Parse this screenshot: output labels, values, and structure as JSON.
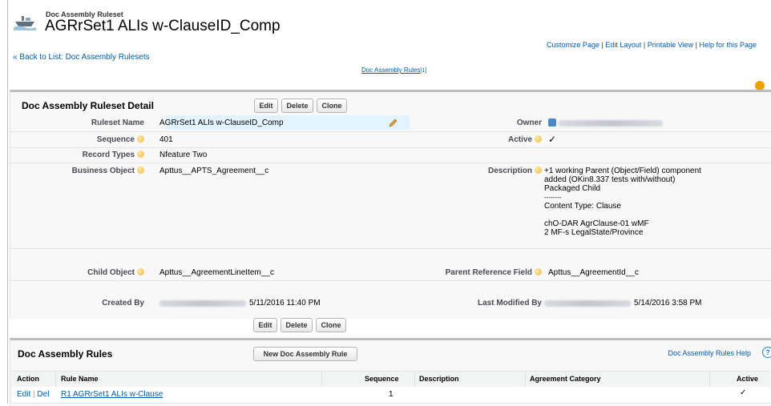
{
  "header": {
    "object_type": "Doc Assembly Ruleset",
    "record_title": "AGRrSet1 ALIs w-ClauseID_Comp",
    "back_link": "« Back to List: Doc Assembly Rulesets",
    "top_links": [
      "Customize Page",
      "Edit Layout",
      "Printable View",
      "Help for this Page"
    ],
    "related_link": "Doc Assembly Rules",
    "related_count": "[1]"
  },
  "detail": {
    "title": "Doc Assembly Ruleset Detail",
    "buttons": {
      "edit": "Edit",
      "delete": "Delete",
      "clone": "Clone"
    },
    "fields": {
      "ruleset_name": {
        "label": "Ruleset Name",
        "value": "AGRrSet1 ALIs w-ClauseID_Comp"
      },
      "owner": {
        "label": "Owner"
      },
      "sequence": {
        "label": "Sequence",
        "value": "401"
      },
      "active": {
        "label": "Active",
        "value": "✓"
      },
      "record_types": {
        "label": "Record Types",
        "value": "Nfeature Two"
      },
      "business_object": {
        "label": "Business Object",
        "value": "Apttus__APTS_Agreement__c"
      },
      "description": {
        "label": "Description",
        "lines": [
          "+1 working Parent (Object/Field) component",
          "added (OKin8.337 tests with/without)",
          "Packaged Child",
          "--------",
          "Content Type: Clause",
          "",
          "chO-DAR AgrClause-01 wMF",
          "2 MF-s LegalState/Province"
        ]
      },
      "child_object": {
        "label": "Child Object",
        "value": "Apttus__AgreementLineItem__c"
      },
      "parent_reference_field": {
        "label": "Parent Reference Field",
        "value": "Apttus__AgreementId__c"
      },
      "created_by": {
        "label": "Created By",
        "date": "5/11/2016 11:40 PM"
      },
      "last_modified_by": {
        "label": "Last Modified By",
        "date": "5/14/2016 3:58 PM"
      }
    }
  },
  "related_list": {
    "title": "Doc Assembly Rules",
    "new_button": "New Doc Assembly Rule",
    "help_link": "Doc Assembly Rules Help",
    "help_icon": "?",
    "columns": [
      "Action",
      "Rule Name",
      "Sequence",
      "Description",
      "Agreement Category",
      "Active"
    ],
    "rows": [
      {
        "edit": "Edit",
        "sep": "|",
        "del": "Del",
        "rule_name": "R1 AGRrSet1 ALIs w-Clause",
        "sequence": "1",
        "description": "",
        "agreement_category": "",
        "active": "✓"
      }
    ]
  },
  "icons": {
    "record": "ruleset-ship-icon",
    "pencil": "pencil-icon",
    "hint": "info-hint-icon",
    "help": "help-orb-icon"
  },
  "colors": {
    "link": "#015ba7",
    "header_border": "#bcbcbc",
    "hint": "#f3b747",
    "edit_highlight": "#e3f3ff"
  }
}
